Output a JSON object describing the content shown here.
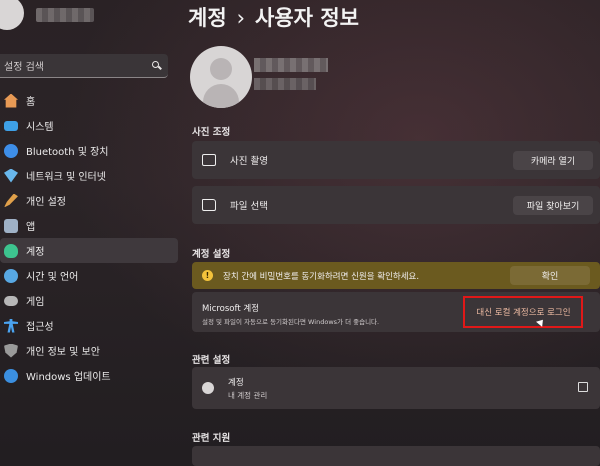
{
  "sidebar": {
    "search_placeholder": "설정 검색",
    "items": [
      {
        "label": "홈",
        "icon": "home-icon",
        "color": "#e89a55"
      },
      {
        "label": "시스템",
        "icon": "system-icon",
        "color": "#3ea0e6"
      },
      {
        "label": "Bluetooth 및 장치",
        "icon": "bluetooth-icon",
        "color": "#3e8ee8"
      },
      {
        "label": "네트워크 및 인터넷",
        "icon": "wifi-icon",
        "color": "#69b7ec"
      },
      {
        "label": "개인 설정",
        "icon": "brush-icon",
        "color": "#e0a04a"
      },
      {
        "label": "앱",
        "icon": "apps-icon",
        "color": "#9fb1c6"
      },
      {
        "label": "계정",
        "icon": "account-icon",
        "color": "#3dc48f"
      },
      {
        "label": "시간 및 언어",
        "icon": "globe-icon",
        "color": "#58a8e3"
      },
      {
        "label": "게임",
        "icon": "gamepad-icon",
        "color": "#b7b7b7"
      },
      {
        "label": "접근성",
        "icon": "accessibility-icon",
        "color": "#4aa3f0"
      },
      {
        "label": "개인 정보 및 보안",
        "icon": "shield-icon",
        "color": "#9a9a9a"
      },
      {
        "label": "Windows 업데이트",
        "icon": "update-icon",
        "color": "#3b8fe0"
      }
    ],
    "active_index": 6
  },
  "header": {
    "crumb1": "계정",
    "separator": "›",
    "crumb2": "사용자 정보"
  },
  "photo": {
    "section_title": "사진 조정",
    "camera_label": "사진 촬영",
    "camera_button": "카메라 열기",
    "file_label": "파일 선택",
    "file_button": "파일 찾아보기"
  },
  "account_settings": {
    "section_title": "계정 설정",
    "warning_icon_glyph": "!",
    "warning_text": "장치 간에 비밀번호를 동기화하려면 신원을 확인하세요.",
    "warning_button": "확인",
    "ms_title": "Microsoft 계정",
    "ms_desc": "설정 및 파일이 자동으로 동기화된다면 Windows가 더 좋습니다.",
    "local_button": "대신 로컬 계정으로 로그인"
  },
  "related": {
    "section_title": "관련 설정",
    "accounts_title": "계정",
    "accounts_desc": "내 계정 관리"
  },
  "support": {
    "section_title": "관련 지원"
  },
  "colors": {
    "warning_bg": "#6b5a1f",
    "highlight_red": "#e01818"
  }
}
